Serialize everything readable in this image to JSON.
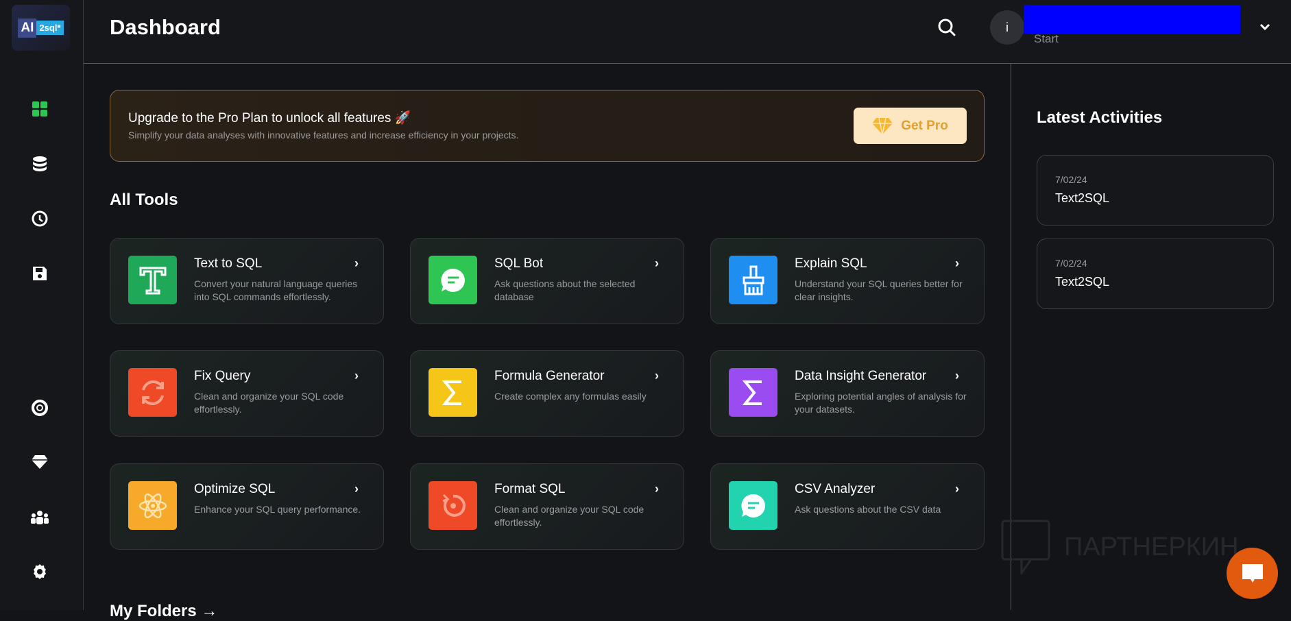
{
  "logo": {
    "ai": "AI",
    "sql": "2sql*"
  },
  "header": {
    "title": "Dashboard",
    "avatar_initial": "i",
    "plan": "Start"
  },
  "banner": {
    "title": "Upgrade to the Pro Plan to unlock all features 🚀",
    "subtitle": "Simplify your data analyses with innovative features and increase efficiency in your projects.",
    "button": "Get Pro"
  },
  "tools": {
    "heading": "All Tools",
    "items": [
      {
        "title": "Text to SQL",
        "desc": "Convert your natural language queries into SQL commands effortlessly.",
        "color": "#1fa857"
      },
      {
        "title": "SQL Bot",
        "desc": "Ask questions about the selected database",
        "color": "#2ec553"
      },
      {
        "title": "Explain SQL",
        "desc": "Understand your SQL queries better for clear insights.",
        "color": "#1e8ff0"
      },
      {
        "title": "Fix Query",
        "desc": "Clean and organize your SQL code effortlessly.",
        "color": "#ee4a28"
      },
      {
        "title": "Formula Generator",
        "desc": "Create complex any formulas easily",
        "color": "#f5c518"
      },
      {
        "title": "Data Insight Generator",
        "desc": "Exploring potential angles of analysis for your datasets.",
        "color": "#9a4cf0"
      },
      {
        "title": "Optimize SQL",
        "desc": "Enhance your SQL query performance.",
        "color": "#f7a929"
      },
      {
        "title": "Format SQL",
        "desc": "Clean and organize your SQL code effortlessly.",
        "color": "#ee4a28"
      },
      {
        "title": "CSV Analyzer",
        "desc": "Ask questions about the CSV data",
        "color": "#22d3b0"
      }
    ]
  },
  "folders": {
    "heading": "My Folders →"
  },
  "activities": {
    "heading": "Latest Activities",
    "items": [
      {
        "date": "7/02/24",
        "name": "Text2SQL"
      },
      {
        "date": "7/02/24",
        "name": "Text2SQL"
      }
    ]
  },
  "watermark": "ПАРТНЕРКИН"
}
